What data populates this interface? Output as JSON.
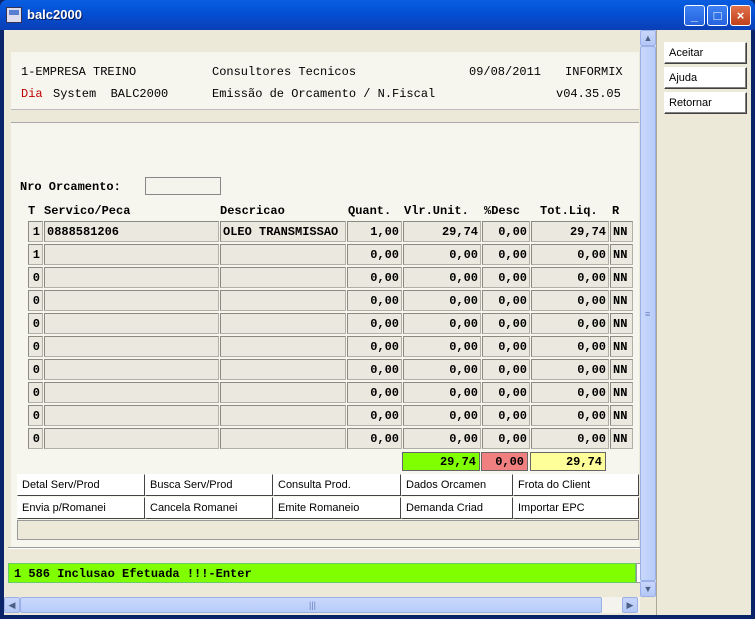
{
  "window": {
    "title": "balc2000"
  },
  "header": {
    "line1_left": "1-EMPRESA TREINO",
    "line1_center": "Consultores Tecnicos",
    "line1_date": "09/08/2011",
    "line1_right": "INFORMIX",
    "line2_dia": "Dia",
    "line2_left": "System  BALC2000",
    "line2_center": "Emissão de Orcamento / N.Fiscal",
    "line2_right": "v04.35.05"
  },
  "form": {
    "nro_label": "Nro Orcamento:",
    "nro_value": ""
  },
  "table": {
    "columns": [
      "T",
      "Servico/Peca",
      "Descricao",
      "Quant.",
      "Vlr.Unit.",
      "%Desc",
      "Tot.Liq.",
      "R"
    ],
    "rows": [
      [
        "1",
        "0888581206",
        "OLEO TRANSMISSAO",
        "1,00",
        "29,74",
        "0,00",
        "29,74",
        "NN"
      ],
      [
        "1",
        "",
        "",
        "0,00",
        "0,00",
        "0,00",
        "0,00",
        "NN"
      ],
      [
        "0",
        "",
        "",
        "0,00",
        "0,00",
        "0,00",
        "0,00",
        "NN"
      ],
      [
        "0",
        "",
        "",
        "0,00",
        "0,00",
        "0,00",
        "0,00",
        "NN"
      ],
      [
        "0",
        "",
        "",
        "0,00",
        "0,00",
        "0,00",
        "0,00",
        "NN"
      ],
      [
        "0",
        "",
        "",
        "0,00",
        "0,00",
        "0,00",
        "0,00",
        "NN"
      ],
      [
        "0",
        "",
        "",
        "0,00",
        "0,00",
        "0,00",
        "0,00",
        "NN"
      ],
      [
        "0",
        "",
        "",
        "0,00",
        "0,00",
        "0,00",
        "0,00",
        "NN"
      ],
      [
        "0",
        "",
        "",
        "0,00",
        "0,00",
        "0,00",
        "0,00",
        "NN"
      ],
      [
        "0",
        "",
        "",
        "0,00",
        "0,00",
        "0,00",
        "0,00",
        "NN"
      ]
    ]
  },
  "totals": {
    "unit_total": "29,74",
    "unit_color": "#80ff00",
    "desc_total": "0,00",
    "desc_color": "#f08080",
    "liq_total": "29,74",
    "liq_color": "#ffff99"
  },
  "actions": {
    "row1": [
      "Detal Serv/Prod",
      "Busca Serv/Prod",
      "Consulta Prod.",
      "Dados Orcamen",
      "Frota do Client"
    ],
    "row2": [
      "Envia p/Romanei",
      "Cancela Romanei",
      "Emite Romaneio",
      "Demanda Criad",
      "Importar EPC"
    ]
  },
  "status": {
    "message": "1 586 Inclusao Efetuada !!!-Enter",
    "color": "#80ff00"
  },
  "sidebar": {
    "buttons": [
      "Aceitar",
      "Ajuda",
      "Retornar"
    ]
  }
}
